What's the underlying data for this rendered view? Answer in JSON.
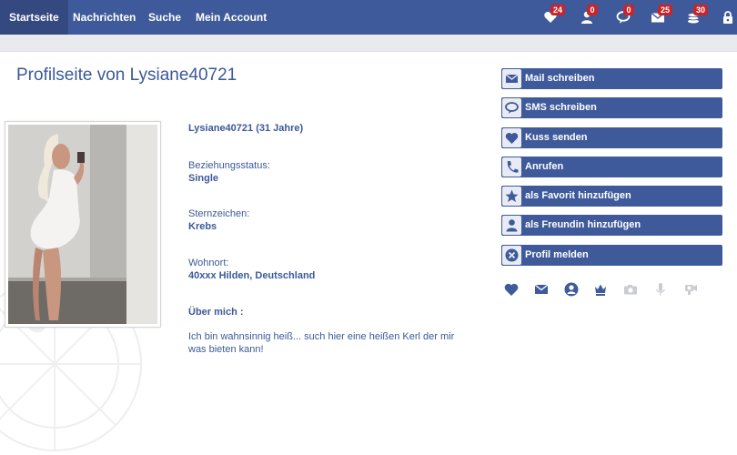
{
  "nav": {
    "items": [
      {
        "label": "Startseite"
      },
      {
        "label": "Nachrichten"
      },
      {
        "label": "Suche"
      },
      {
        "label": "Mein Account"
      }
    ],
    "badges": {
      "kisses": "24",
      "visitors": "0",
      "sms": "0",
      "mails": "25",
      "coins": "30"
    },
    "icons": [
      "heart-icon",
      "person-icon",
      "chat-bubble-icon",
      "mail-icon",
      "coins-icon",
      "lock-icon"
    ]
  },
  "profile": {
    "title": "Profilseite von Lysiane40721",
    "name_age": "Lysiane40721 (31 Jahre)",
    "relationship_label": "Beziehungsstatus:",
    "relationship_value": "Single",
    "zodiac_label": "Sternzeichen:",
    "zodiac_value": "Krebs",
    "location_label": "Wohnort:",
    "location_value": "40xxx Hilden, Deutschland",
    "about_label": "Über mich :",
    "about_text": "Ich bin wahnsinnig heiß... such hier eine heißen Kerl der mir was bieten kann!"
  },
  "actions": [
    {
      "label": "Mail schreiben",
      "icon": "mail-icon"
    },
    {
      "label": "SMS schreiben",
      "icon": "chat-bubble-icon"
    },
    {
      "label": "Kuss senden",
      "icon": "heart-icon"
    },
    {
      "label": "Anrufen",
      "icon": "phone-icon"
    },
    {
      "label": "als Favorit hinzufügen",
      "icon": "star-icon"
    },
    {
      "label": "als Freundin hinzufügen",
      "icon": "person-icon"
    },
    {
      "label": "Profil melden",
      "icon": "close-circle-icon"
    }
  ],
  "mini_icons": [
    "heart-icon",
    "mail-icon",
    "user-circle-icon",
    "crown-icon",
    "camera-icon",
    "microphone-icon",
    "webcam-icon"
  ],
  "colors": {
    "nav": "#3f5a9a",
    "accent": "#3b5998",
    "badge": "#c8252b"
  }
}
